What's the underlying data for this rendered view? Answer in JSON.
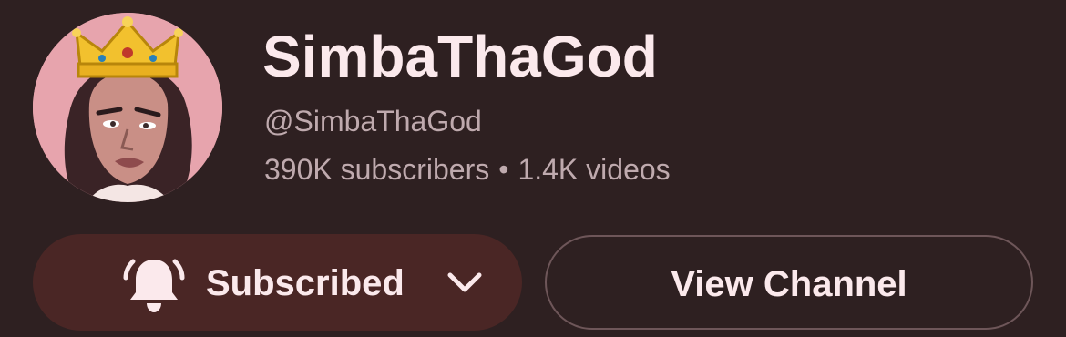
{
  "channel": {
    "name": "SimbaThaGod",
    "handle": "@SimbaThaGod",
    "subscribers": "390K subscribers",
    "separator": "•",
    "videos": "1.4K videos",
    "avatar_icon": "crowned-portrait-avatar"
  },
  "actions": {
    "subscribe_label": "Subscribed",
    "view_channel_label": "View Channel",
    "bell_icon": "bell-icon",
    "chevron_icon": "chevron-down-icon"
  },
  "colors": {
    "background": "#2e2021",
    "subscribed_button": "#4a2625",
    "text_primary": "#fbe9ec",
    "text_secondary": "#bfaaae",
    "avatar_background": "#e7a4ad",
    "crown": "#f2c12e"
  }
}
